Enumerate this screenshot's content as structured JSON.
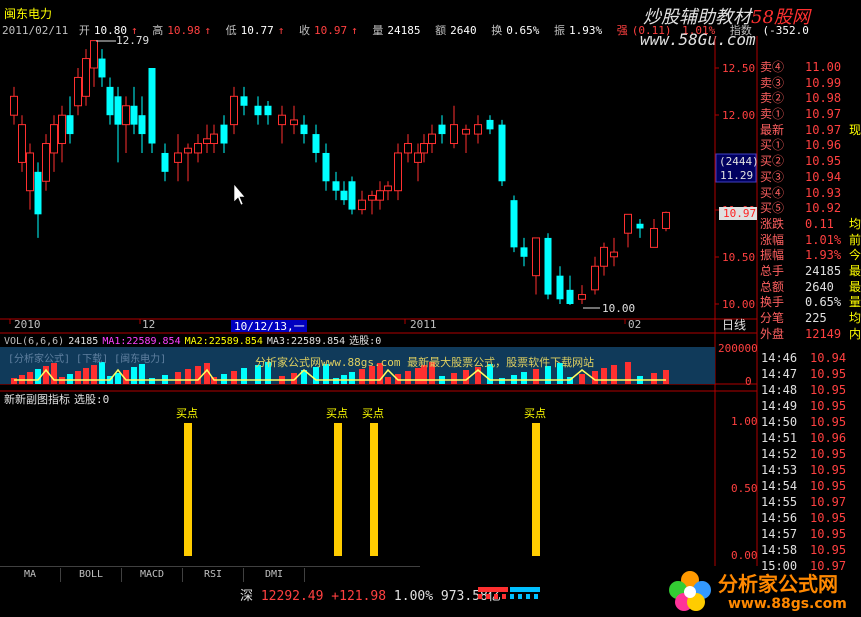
{
  "header": {
    "stock_name": "闽东电力",
    "date": "2011/02/11",
    "open_label": "开",
    "open": "10.80",
    "high_label": "高",
    "high": "10.98",
    "low_label": "低",
    "low": "10.77",
    "close_label": "收",
    "close": "10.97",
    "volume_label": "量",
    "volume": "24185",
    "amount_label": "额",
    "amount": "2640",
    "turnover_label": "换",
    "turnover": "0.65%",
    "amplitude_label": "振",
    "amplitude": "1.93%",
    "strength_label": "强",
    "strength": "(0.11)",
    "strength_pct": "1.01%",
    "index_label": "指数",
    "index_value": "(-352.0"
  },
  "watermark": {
    "top_black": "炒股辅助教材",
    "top_red": "58股网",
    "url": "www.58Gu.com"
  },
  "main_chart": {
    "price_axis": [
      "12.50",
      "12.00",
      "11.50",
      "11.00",
      "10.50",
      "10.00"
    ],
    "high_annotation": "12.79",
    "low_annotation": "10.00",
    "crosshair_box_top": "(2444)",
    "crosshair_box_bottom": "11.29",
    "current_price_tag": "10.97",
    "time_axis": [
      "2010",
      "12",
      "10/12/13,一",
      "2011",
      "02"
    ],
    "period_label": "日线"
  },
  "volume_panel": {
    "title": "VOL(6,6,6)",
    "vol": "24185",
    "ma1": "MA1:22589.854",
    "ma2": "MA2:22589.854",
    "ma3": "MA3:22589.854",
    "select": "选股:0",
    "axis_top": "200000",
    "axis_bottom": "0",
    "overlay_tag": "[分析家公式] [下载] [闽东电力]",
    "overlay_text": "分析家公式网www.88gs.com 最新最大股票公式，股票软件下载网站"
  },
  "indicator_panel": {
    "title": "新新副图指标",
    "select": "选股:0",
    "axis": [
      "1.00",
      "0.50",
      "0.00"
    ],
    "signal_label": "买点"
  },
  "orderbook": [
    {
      "name": "卖④",
      "value": "11.00"
    },
    {
      "name": "卖③",
      "value": "10.99"
    },
    {
      "name": "卖②",
      "value": "10.98"
    },
    {
      "name": "卖①",
      "value": "10.97"
    },
    {
      "name": "最新",
      "value": "10.97",
      "extra": "现"
    },
    {
      "name": "买①",
      "value": "10.96"
    },
    {
      "name": "买②",
      "value": "10.95"
    },
    {
      "name": "买③",
      "value": "10.94"
    },
    {
      "name": "买④",
      "value": "10.93"
    },
    {
      "name": "买⑤",
      "value": "10.92"
    },
    {
      "name": "涨跌",
      "value": "0.11",
      "extra": "均"
    },
    {
      "name": "涨幅",
      "value": "1.01%",
      "extra": "前"
    },
    {
      "name": "振幅",
      "value": "1.93%",
      "extra": "今"
    },
    {
      "name": "总手",
      "value": "24185",
      "extra": "最"
    },
    {
      "name": "总额",
      "value": "2640",
      "extra": "最"
    },
    {
      "name": "换手",
      "value": "0.65%",
      "extra": "量"
    },
    {
      "name": "分笔",
      "value": "225",
      "extra": "均"
    },
    {
      "name": "外盘",
      "value": "12149",
      "extra": "内"
    }
  ],
  "ticks": [
    {
      "time": "14:46",
      "price": "10.94"
    },
    {
      "time": "14:47",
      "price": "10.95"
    },
    {
      "time": "14:48",
      "price": "10.95"
    },
    {
      "time": "14:49",
      "price": "10.95"
    },
    {
      "time": "14:50",
      "price": "10.95"
    },
    {
      "time": "14:51",
      "price": "10.96"
    },
    {
      "time": "14:52",
      "price": "10.95"
    },
    {
      "time": "14:53",
      "price": "10.95"
    },
    {
      "time": "14:54",
      "price": "10.95"
    },
    {
      "time": "14:55",
      "price": "10.97"
    },
    {
      "time": "14:56",
      "price": "10.95"
    },
    {
      "time": "14:57",
      "price": "10.95"
    },
    {
      "time": "14:58",
      "price": "10.95"
    },
    {
      "time": "15:00",
      "price": "10.97"
    }
  ],
  "tabs": [
    "MA",
    "BOLL",
    "MACD",
    "RSI",
    "DMI"
  ],
  "status": {
    "market": "深",
    "index": "12292.49",
    "change": "+121.98",
    "pct": "1.00%",
    "amount": "973.58亿"
  },
  "logo": {
    "text": "分析家公式网",
    "url": "www.88gs.com"
  },
  "colors": {
    "up": "#ff3030",
    "down": "#00ffff",
    "axis": "#b00000",
    "signal": "#ffcc00"
  }
}
